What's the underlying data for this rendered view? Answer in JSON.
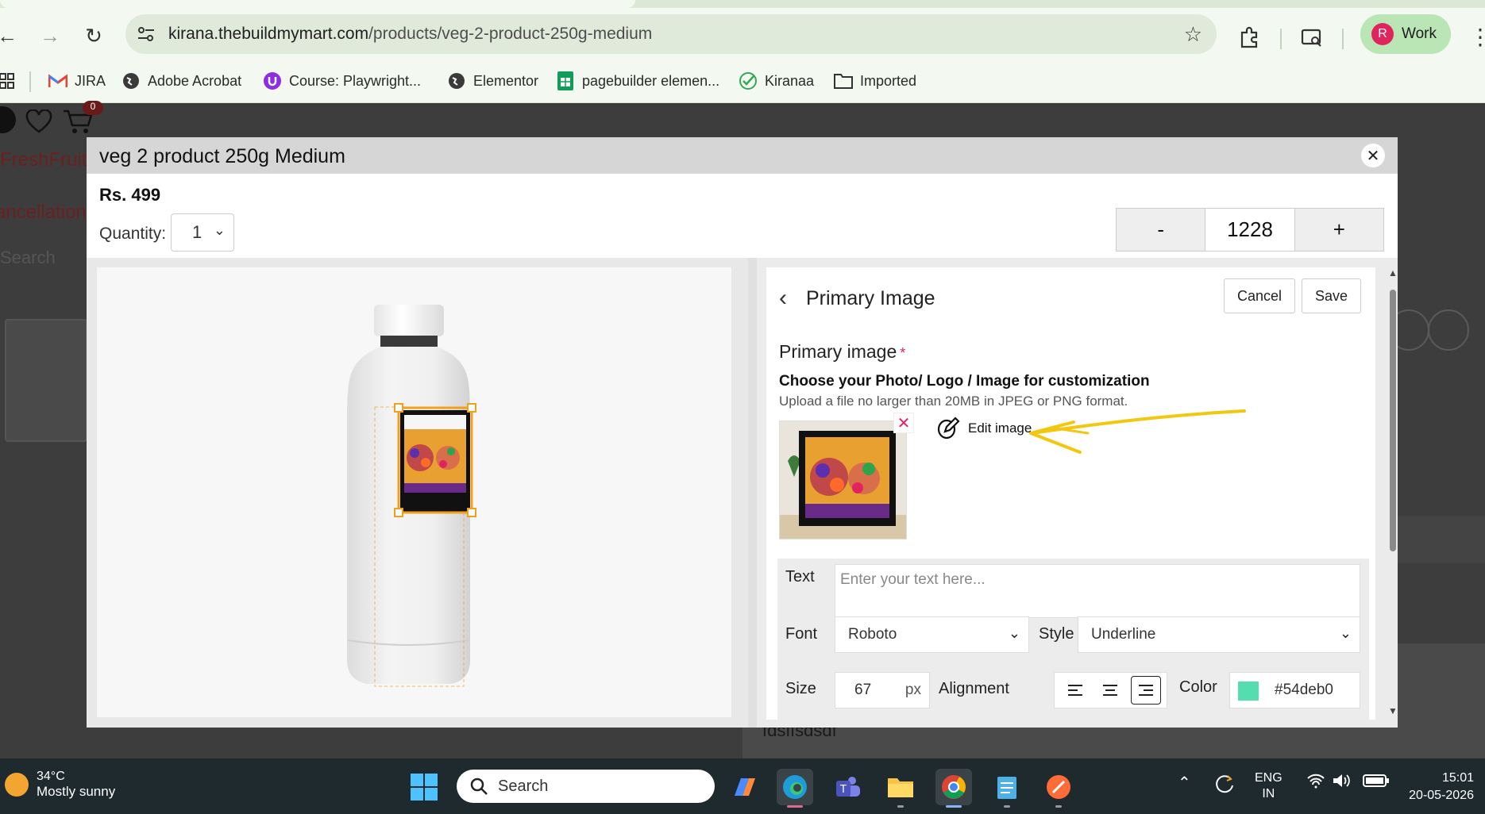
{
  "browser": {
    "url_host": "kirana.thebuildmymart.com",
    "url_path": "/products/veg-2-product-250g-medium",
    "profile_initial": "R",
    "profile_label": "Work",
    "bookmarks": [
      {
        "label": "JIRA",
        "icon": "gmail-icon"
      },
      {
        "label": "Adobe Acrobat",
        "icon": "globe-icon"
      },
      {
        "label": "Course: Playwright...",
        "icon": "course-icon"
      },
      {
        "label": "Elementor",
        "icon": "globe-icon"
      },
      {
        "label": "pagebuilder elemen...",
        "icon": "sheets-icon"
      },
      {
        "label": "Kiranaa",
        "icon": "check-icon"
      },
      {
        "label": "Imported",
        "icon": "folder-icon"
      }
    ]
  },
  "background_page": {
    "cart_count": "0",
    "brand_fragment": "FreshFruit",
    "link_fragment": "ancellation",
    "search_fragment": "Search",
    "text_fragment": "fdsffsdsdf"
  },
  "modal": {
    "title": "veg 2 product 250g Medium",
    "price": "Rs. 499",
    "quantity_label": "Quantity:",
    "quantity_value": "1",
    "stepper": {
      "minus": "-",
      "value": "1228",
      "plus": "+"
    },
    "close_symbol": "✕"
  },
  "editor": {
    "title": "Primary Image",
    "cancel_label": "Cancel",
    "save_label": "Save",
    "field_label": "Primary image",
    "required_mark": "*",
    "choose_label": "Choose your Photo/ Logo / Image for customization",
    "upload_note": "Upload a file no larger than 20MB in JPEG or PNG format.",
    "edit_image_label": "Edit image",
    "remove_symbol": "✕",
    "text_label": "Text",
    "text_placeholder": "Enter your text here...",
    "font_label": "Font",
    "font_value": "Roboto",
    "style_label": "Style",
    "style_value": "Underline",
    "size_label": "Size",
    "size_value": "67",
    "size_unit": "px",
    "alignment_label": "Alignment",
    "alignment_selected": "right",
    "color_label": "Color",
    "color_value": "#54deb0"
  },
  "taskbar": {
    "temperature": "34°C",
    "weather": "Mostly sunny",
    "search_label": "Search",
    "lang_top": "ENG",
    "lang_bottom": "IN",
    "time": "15:01",
    "date": "20-05-2026"
  },
  "colors": {
    "accent_swatch": "#54deb0",
    "annotation": "#f2c80f",
    "selection": "#f0a020"
  }
}
